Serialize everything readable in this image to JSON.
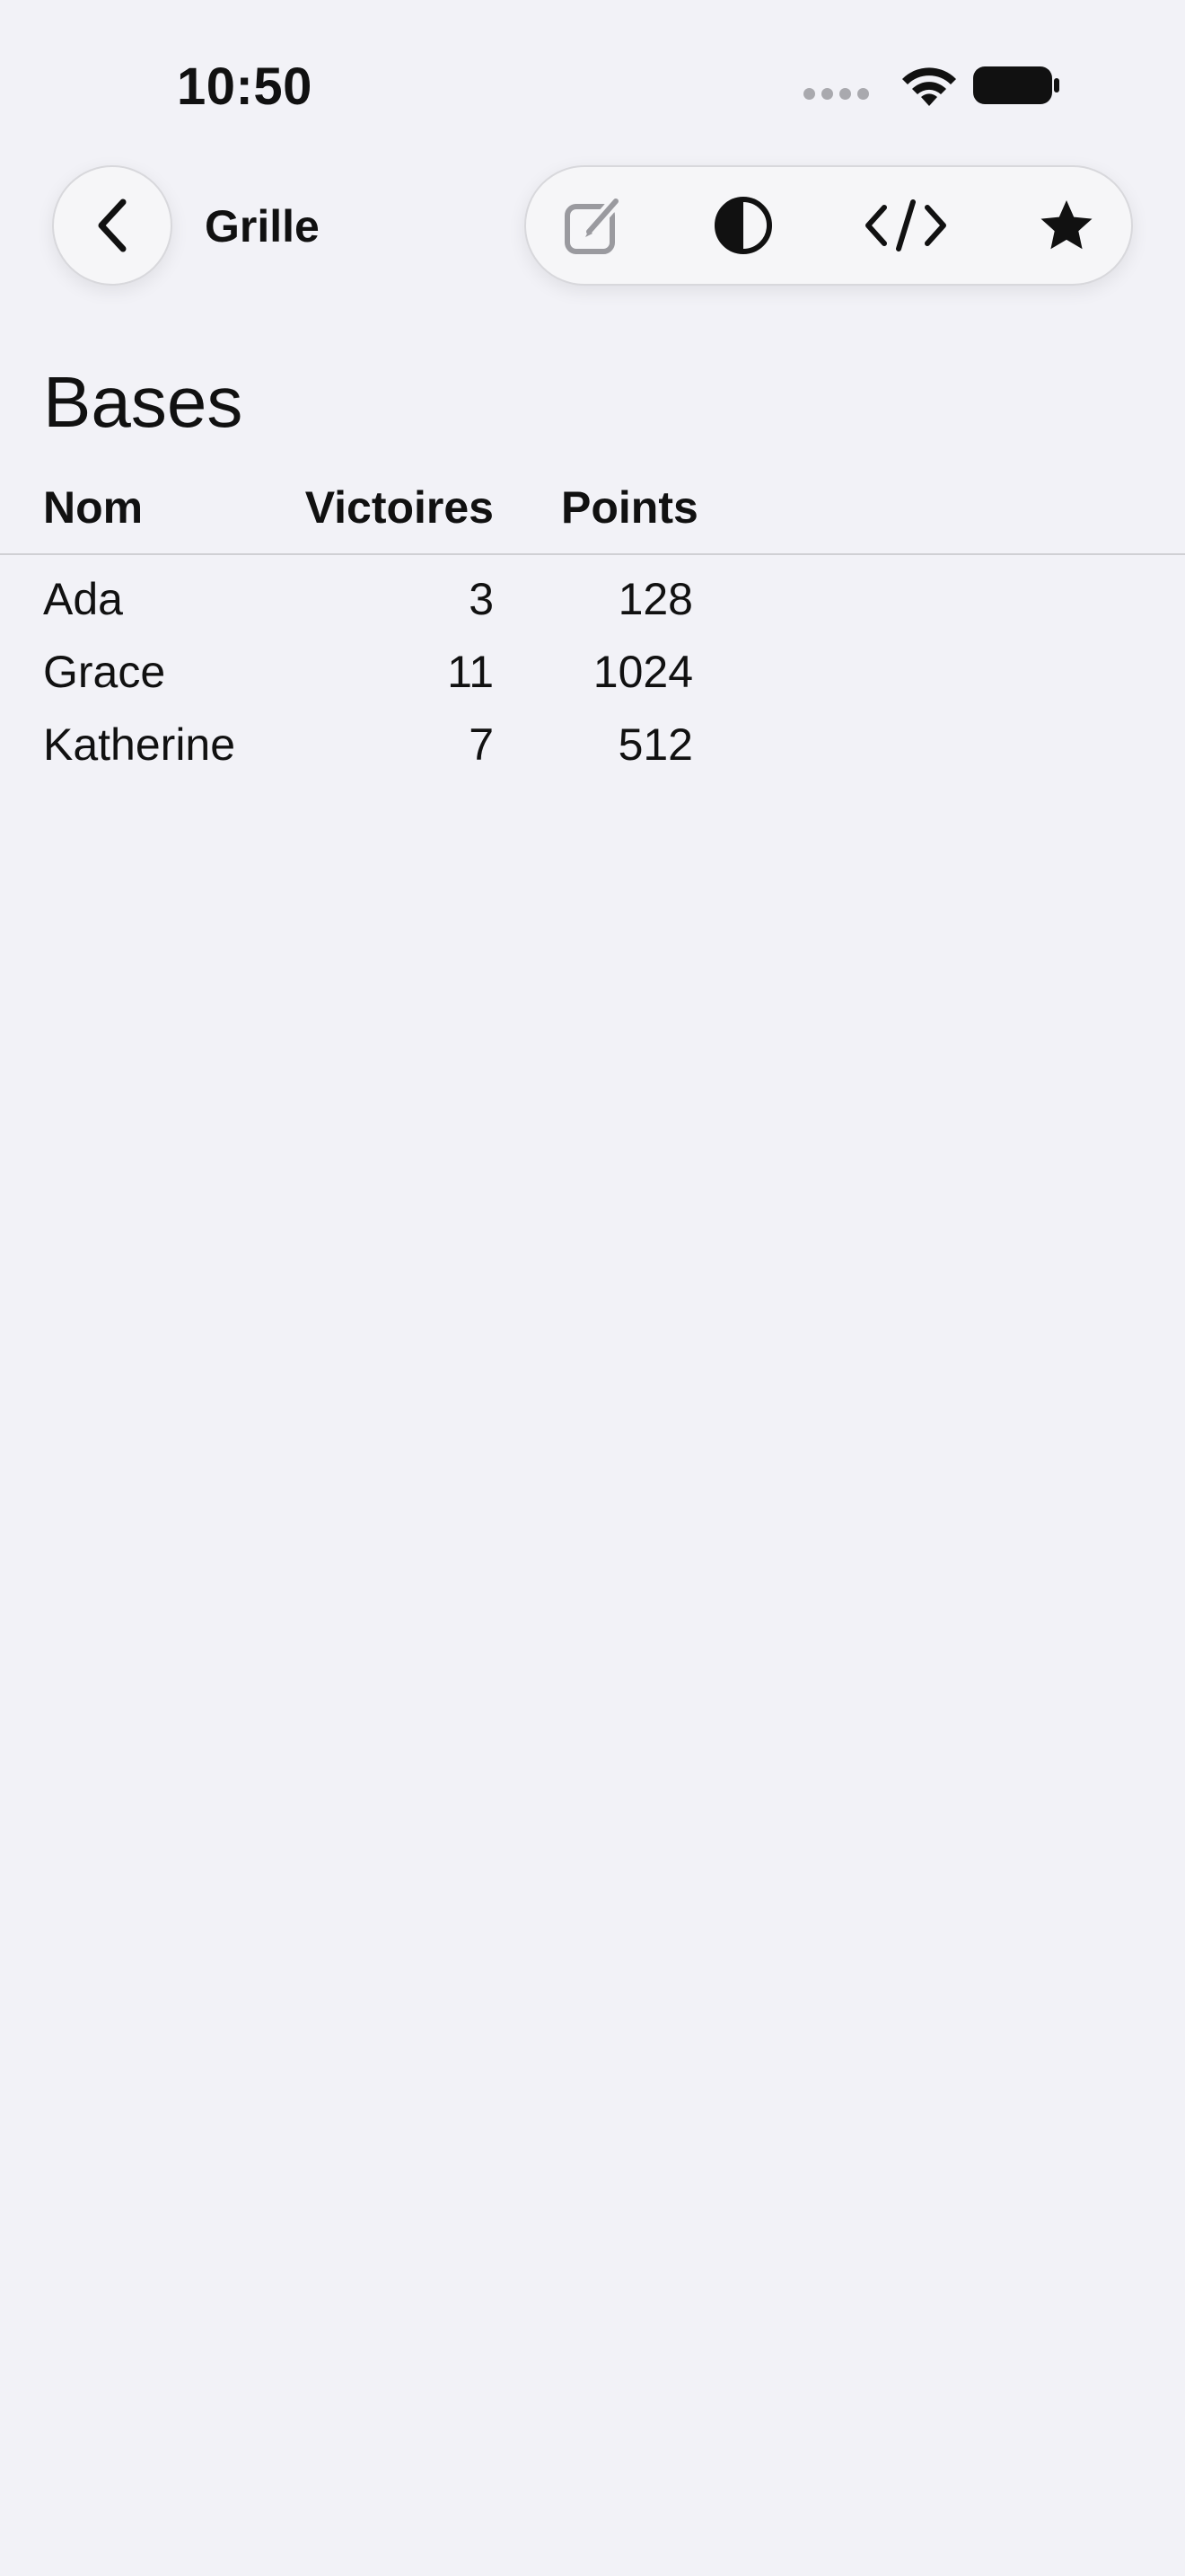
{
  "status_bar": {
    "time": "10:50"
  },
  "nav": {
    "title": "Grille"
  },
  "toolbar": {
    "items": [
      {
        "icon": "edit-icon",
        "enabled": false
      },
      {
        "icon": "contrast-icon",
        "enabled": true
      },
      {
        "icon": "code-icon",
        "enabled": true
      },
      {
        "icon": "star-icon",
        "enabled": true
      }
    ]
  },
  "section": {
    "title": "Bases"
  },
  "table": {
    "columns": [
      "Nom",
      "Victoires",
      "Points"
    ],
    "rows": [
      {
        "name": "Ada",
        "wins": "3",
        "points": "128"
      },
      {
        "name": "Grace",
        "wins": "11",
        "points": "1024"
      },
      {
        "name": "Katherine",
        "wins": "7",
        "points": "512"
      }
    ]
  },
  "colors": {
    "background": "#f2f2f7",
    "text": "#111111",
    "disabled": "#9a9a9f"
  }
}
